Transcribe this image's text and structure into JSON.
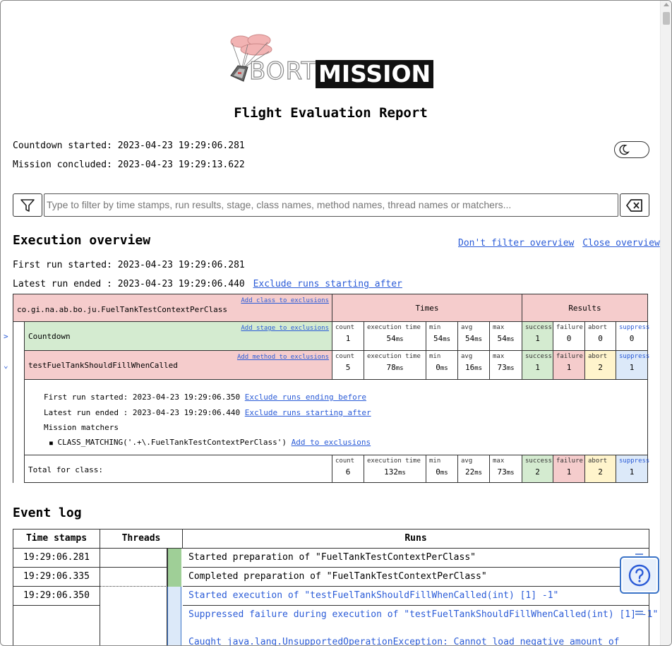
{
  "logo": {
    "part1": "BORT",
    "part2": "MISSION"
  },
  "report_title": "Flight Evaluation Report",
  "countdown_started": "Countdown started: 2023-04-23 19:29:06.281",
  "mission_concluded": "Mission concluded: 2023-04-23 19:29:13.622",
  "filter": {
    "placeholder": "Type to filter by time stamps, run results, stage, class names, method names, thread names or matchers..."
  },
  "overview": {
    "heading": "Execution overview",
    "dont_filter_link": "Don't filter overview",
    "close_link": "Close overview",
    "first_run": "First run started: 2023-04-23 19:29:06.281",
    "latest_run": "Latest run ended : 2023-04-23 19:29:06.440",
    "exclude_after_link": "Exclude runs starting after",
    "table": {
      "class_name": "co.gi.na.ab.bo.ju.FuelTankTestContextPerClass",
      "add_class_link": "Add class to exclusions",
      "times_header": "Times",
      "results_header": "Results",
      "col_labels": {
        "count": "count",
        "exec": "execution time",
        "min": "min",
        "avg": "avg",
        "max": "max",
        "success": "success",
        "failure": "failure",
        "abort": "abort",
        "suppress": "suppress"
      },
      "ms_unit": "ms",
      "rows": [
        {
          "label": "Countdown",
          "add_link": "Add stage to exclusions",
          "count": "1",
          "exec": "54",
          "min": "54",
          "avg": "54",
          "max": "54",
          "success": "1",
          "failure": "0",
          "abort": "0",
          "suppress": "0"
        },
        {
          "label": "testFuelTankShouldFillWhenCalled",
          "add_link": "Add method to exclusions",
          "count": "5",
          "exec": "78",
          "min": "0",
          "avg": "16",
          "max": "73",
          "success": "1",
          "failure": "1",
          "abort": "2",
          "suppress": "1"
        }
      ],
      "details": {
        "first_run_label": "First run started: 2023-04-23 19:29:06.350",
        "exclude_before_link": "Exclude runs ending before",
        "latest_run_label": "Latest run ended : 2023-04-23 19:29:06.440",
        "exclude_after_link": "Exclude runs starting after",
        "matchers_label": "Mission matchers",
        "matcher": "CLASS_MATCHING('.+\\.FuelTankTestContextPerClass')",
        "add_exclusions_link": "Add to exclusions"
      },
      "total": {
        "label": "Total for class:",
        "count": "6",
        "exec": "132",
        "min": "0",
        "avg": "22",
        "max": "73",
        "success": "2",
        "failure": "1",
        "abort": "2",
        "suppress": "1"
      }
    }
  },
  "event_log": {
    "heading": "Event log",
    "headers": {
      "time": "Time stamps",
      "threads": "Threads",
      "runs": "Runs"
    },
    "rows": [
      {
        "time": "19:29:06.281",
        "run": "Started preparation of \"FuelTankTestContextPerClass\""
      },
      {
        "time": "19:29:06.335",
        "run": "Completed preparation of \"FuelTankTestContextPerClass\""
      },
      {
        "time": "19:29:06.350",
        "run": "Started execution of \"testFuelTankShouldFillWhenCalled(int) [1] -1\""
      },
      {
        "time": "",
        "run": "Suppressed failure during execution of \"testFuelTankShouldFillWhenCalled(int) [1] -1\"",
        "run2": "Caught java.lang.UnsupportedOperationException: Cannot load negative amount of"
      }
    ]
  },
  "colors": {
    "link": "#2a5bd7",
    "red": "#f5cccc",
    "green": "#d4ebd0",
    "yellow": "#fff4cc",
    "blue": "#dce9f9"
  },
  "icons": {
    "theme": "moon-icon",
    "filter": "filter-icon",
    "clear": "backspace-icon",
    "help": "help-icon"
  }
}
